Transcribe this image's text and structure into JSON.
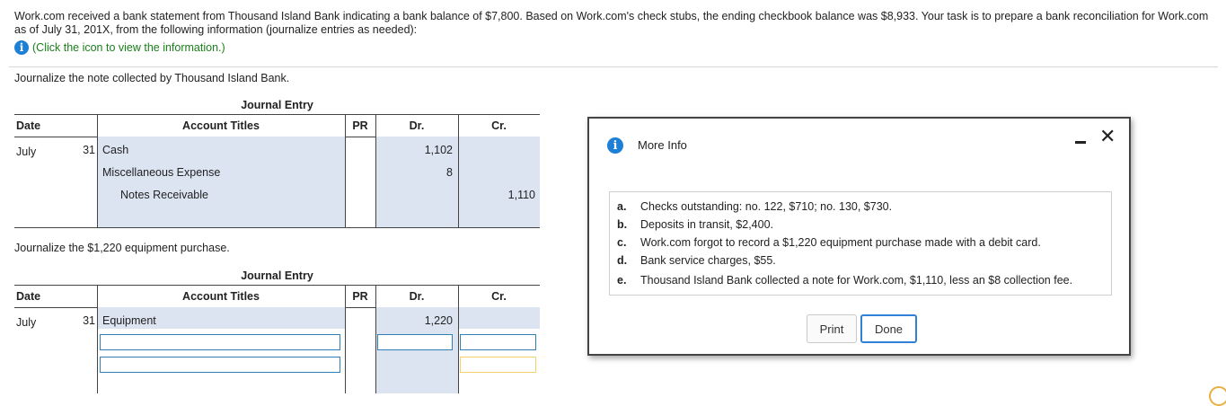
{
  "problem": {
    "intro": "Work.com received a bank statement from Thousand Island Bank indicating a bank balance of $7,800. Based on Work.com's check stubs, the ending checkbook balance was $8,933. Your task is to prepare a bank reconciliation for Work.com as of July 31, 201X, from the following information (journalize entries as needed):",
    "info_link": "(Click the icon to view the information.)"
  },
  "q1": {
    "prompt": "Journalize the note collected by Thousand Island Bank.",
    "title": "Journal Entry",
    "headers": {
      "date": "Date",
      "account": "Account Titles",
      "pr": "PR",
      "dr": "Dr.",
      "cr": "Cr."
    },
    "rows": [
      {
        "month": "July",
        "day": "31",
        "account": "Cash",
        "dr": "1,102",
        "cr": ""
      },
      {
        "month": "",
        "day": "",
        "account": "Miscellaneous Expense",
        "dr": "8",
        "cr": ""
      },
      {
        "month": "",
        "day": "",
        "account": "Notes Receivable",
        "dr": "",
        "cr": "1,110"
      }
    ]
  },
  "q2": {
    "prompt": "Journalize the $1,220 equipment purchase.",
    "title": "Journal Entry",
    "headers": {
      "date": "Date",
      "account": "Account Titles",
      "pr": "PR",
      "dr": "Dr.",
      "cr": "Cr."
    },
    "rows": [
      {
        "month": "July",
        "day": "31",
        "account": "Equipment",
        "dr": "1,220",
        "cr": ""
      }
    ]
  },
  "modal": {
    "title": "More Info",
    "items": [
      {
        "letter": "a.",
        "text": "Checks outstanding: no. 122, $710; no. 130, $730."
      },
      {
        "letter": "b.",
        "text": "Deposits in transit, $2,400."
      },
      {
        "letter": "c.",
        "text": "Work.com forgot to record a $1,220 equipment purchase made with a debit card."
      },
      {
        "letter": "d.",
        "text": "Bank service charges, $55."
      },
      {
        "letter": "e.",
        "text": "Thousand Island Bank collected a note for Work.com, $1,110, less an $8 collection fee."
      }
    ],
    "print_label": "Print",
    "done_label": "Done"
  },
  "icons": {
    "info": "info-icon",
    "close": "close-icon",
    "minimize": "minimize-icon"
  },
  "colors": {
    "accent": "#1e7fd6",
    "link": "#1a7f1a",
    "cell_shade": "#dbe4f0",
    "input_border": "#2f80b7"
  }
}
